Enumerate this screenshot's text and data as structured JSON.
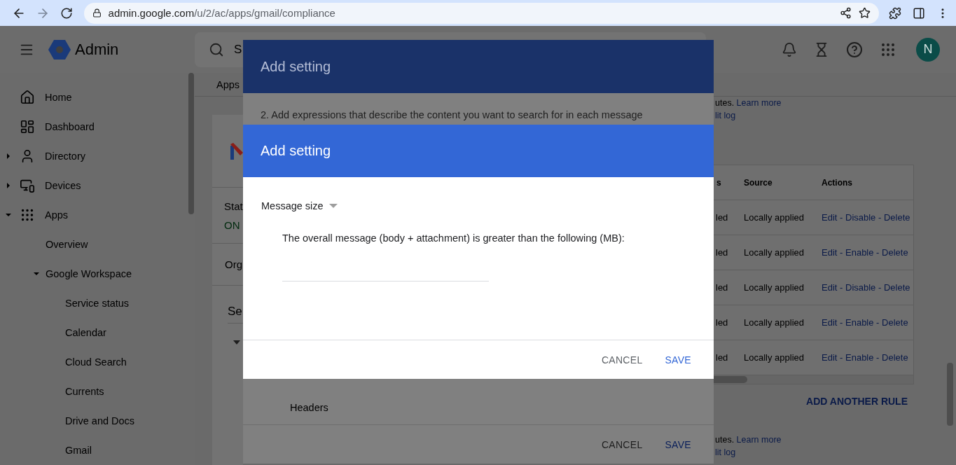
{
  "browser": {
    "url_host": "admin.google.com",
    "url_path": "/u/2/ac/apps/gmail/compliance",
    "forward_disabled": true
  },
  "app_header": {
    "product": "Admin",
    "search_placeholder": "S",
    "avatar": "N"
  },
  "sidebar": {
    "items": [
      {
        "label": "Home"
      },
      {
        "label": "Dashboard"
      },
      {
        "label": "Directory",
        "expanded": false
      },
      {
        "label": "Devices",
        "expanded": false
      },
      {
        "label": "Apps",
        "expanded": true,
        "children": [
          {
            "label": "Overview"
          },
          {
            "label": "Google Workspace",
            "expanded": true,
            "children": [
              {
                "label": "Service status"
              },
              {
                "label": "Calendar"
              },
              {
                "label": "Cloud Search"
              },
              {
                "label": "Currents"
              },
              {
                "label": "Drive and Docs"
              },
              {
                "label": "Gmail"
              }
            ]
          }
        ]
      }
    ]
  },
  "main": {
    "breadcrumb": "Apps",
    "card": {
      "status_label": "Stat",
      "status_value": "ON",
      "org_label": "Org",
      "search_placeholder": "Se"
    },
    "notices": [
      {
        "text": "utes.",
        "link": "Learn more",
        "audit_link": "lit log"
      },
      {
        "text": "utes.",
        "link": "Learn more",
        "audit_link": "lit log"
      }
    ],
    "table": {
      "columns": [
        "s",
        "Source",
        "Actions"
      ],
      "rows": [
        {
          "column_1": "led",
          "source": "Locally applied",
          "actions": [
            "Edit",
            "-",
            "Disable",
            "-",
            "Delete"
          ]
        },
        {
          "column_1": "led",
          "source": "Locally applied",
          "actions": [
            "Edit",
            "-",
            "Enable",
            "-",
            "Delete"
          ]
        },
        {
          "column_1": "led",
          "source": "Locally applied",
          "actions": [
            "Edit",
            "-",
            "Disable",
            "-",
            "Delete"
          ]
        },
        {
          "column_1": "led",
          "source": "Locally applied",
          "actions": [
            "Edit",
            "-",
            "Enable",
            "-",
            "Delete"
          ]
        },
        {
          "column_1": "led",
          "source": "Locally applied",
          "actions": [
            "Edit",
            "-",
            "Enable",
            "-",
            "Delete"
          ]
        }
      ]
    },
    "add_rule_button": "ADD ANOTHER RULE"
  },
  "back_dialog": {
    "title": "Add setting",
    "instruction": "2. Add expressions that describe the content you want to search for in each message",
    "section": "Headers",
    "buttons": [
      {
        "label": "CANCEL",
        "kind": "secondary"
      },
      {
        "label": "SAVE",
        "kind": "primary"
      }
    ]
  },
  "front_dialog": {
    "title": "Add setting",
    "condition": "Message size",
    "description": "The overall message (body + attachment) is greater than the following (MB):",
    "buttons": [
      {
        "label": "CANCEL",
        "kind": "secondary"
      },
      {
        "label": "SAVE",
        "kind": "primary"
      }
    ]
  }
}
